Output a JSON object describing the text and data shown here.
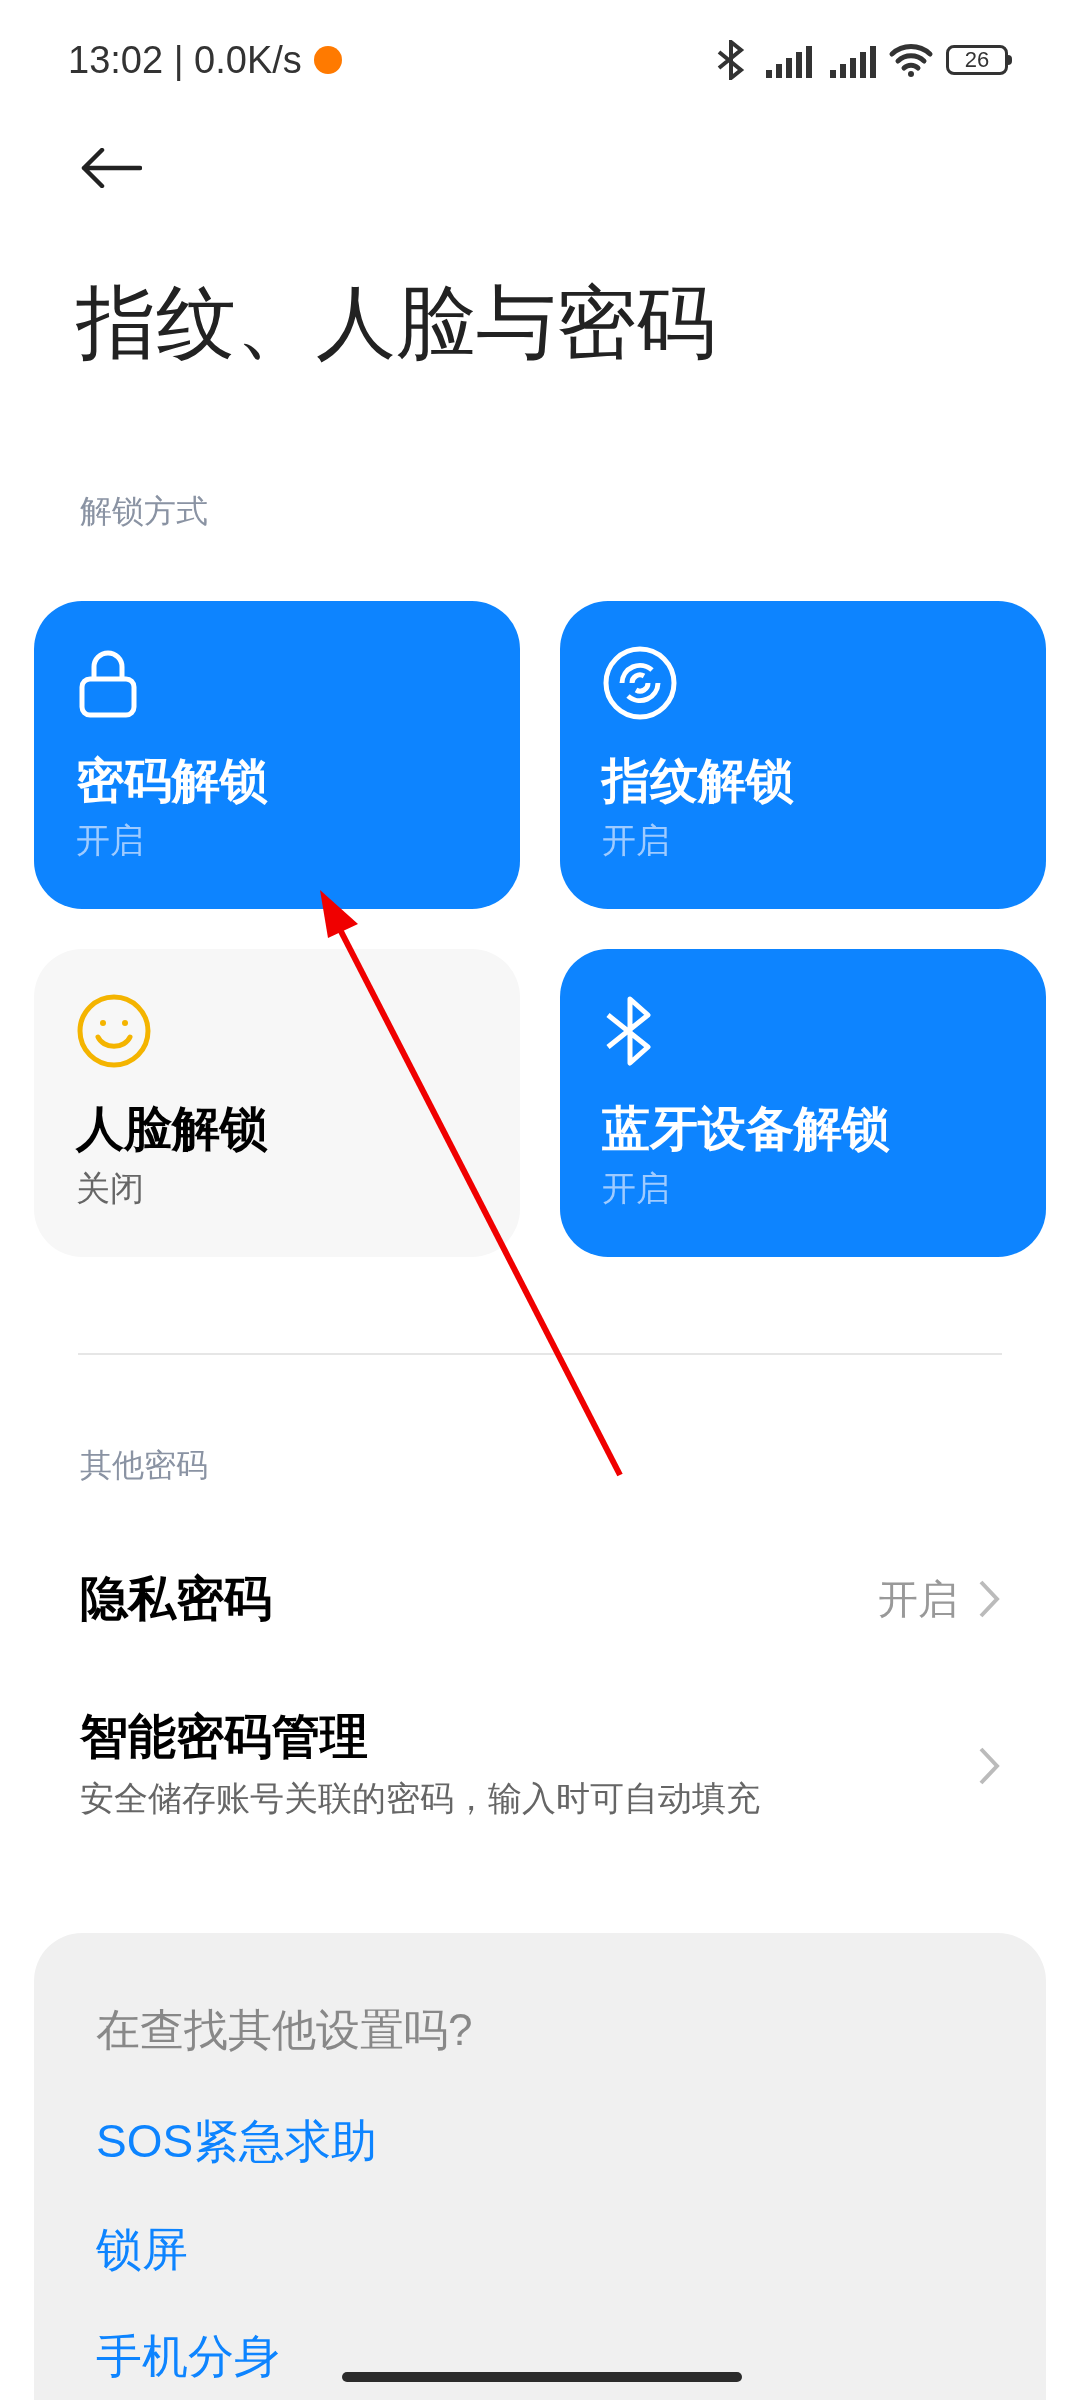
{
  "status_bar": {
    "time": "13:02 | 0.0K/s",
    "battery": "26"
  },
  "title": "指纹、人脸与密码",
  "unlock_section": {
    "label": "解锁方式",
    "tiles": [
      {
        "title": "密码解锁",
        "status": "开启",
        "on": true
      },
      {
        "title": "指纹解锁",
        "status": "开启",
        "on": true
      },
      {
        "title": "人脸解锁",
        "status": "关闭",
        "on": false
      },
      {
        "title": "蓝牙设备解锁",
        "status": "开启",
        "on": true
      }
    ]
  },
  "other_section": {
    "label": "其他密码",
    "rows": [
      {
        "title": "隐私密码",
        "value": "开启"
      },
      {
        "title": "智能密码管理",
        "subtitle": "安全储存账号关联的密码，输入时可自动填充"
      }
    ]
  },
  "suggestions": {
    "heading": "在查找其他设置吗?",
    "links": [
      "SOS紧急求助",
      "锁屏",
      "手机分身"
    ]
  }
}
